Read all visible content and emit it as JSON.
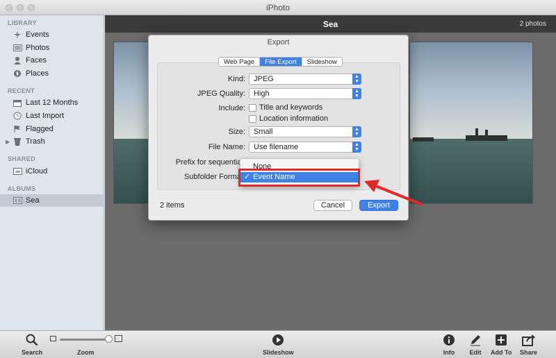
{
  "window": {
    "title": "iPhoto"
  },
  "sidebar": {
    "sections": [
      {
        "heading": "LIBRARY",
        "items": [
          {
            "label": "Events",
            "icon": "events-icon"
          },
          {
            "label": "Photos",
            "icon": "photos-icon"
          },
          {
            "label": "Faces",
            "icon": "faces-icon"
          },
          {
            "label": "Places",
            "icon": "places-icon"
          }
        ]
      },
      {
        "heading": "RECENT",
        "items": [
          {
            "label": "Last 12 Months",
            "icon": "calendar-icon"
          },
          {
            "label": "Last Import",
            "icon": "clock-icon"
          },
          {
            "label": "Flagged",
            "icon": "flag-icon"
          },
          {
            "label": "Trash",
            "icon": "trash-icon"
          }
        ]
      },
      {
        "heading": "SHARED",
        "items": [
          {
            "label": "iCloud",
            "icon": "icloud-icon"
          }
        ]
      },
      {
        "heading": "ALBUMS",
        "items": [
          {
            "label": "Sea",
            "icon": "album-icon",
            "selected": true
          }
        ]
      }
    ]
  },
  "main": {
    "title": "Sea",
    "photo_count": "2 photos"
  },
  "dialog": {
    "title": "Export",
    "tabs": [
      {
        "label": "Web Page",
        "active": false
      },
      {
        "label": "File Export",
        "active": true
      },
      {
        "label": "Slideshow",
        "active": false
      }
    ],
    "fields": {
      "kind": {
        "label": "Kind:",
        "value": "JPEG"
      },
      "jpeg_quality": {
        "label": "JPEG Quality:",
        "value": "High"
      },
      "include": {
        "label": "Include:",
        "options": [
          "Title and keywords",
          "Location information"
        ],
        "checked": [
          false,
          false
        ]
      },
      "size": {
        "label": "Size:",
        "value": "Small"
      },
      "file_name": {
        "label": "File Name:",
        "value": "Use filename"
      },
      "prefix": {
        "label": "Prefix for sequential:"
      },
      "subfolder_format": {
        "label": "Subfolder Format:"
      }
    },
    "popup_options": [
      {
        "label": "None",
        "selected": false
      },
      {
        "label": "Event Name",
        "selected": true
      }
    ],
    "items_count": "2 items",
    "cancel_label": "Cancel",
    "export_label": "Export"
  },
  "toolbar": {
    "search_label": "Search",
    "zoom_label": "Zoom",
    "slideshow_label": "Slideshow",
    "info_label": "Info",
    "edit_label": "Edit",
    "add_to_label": "Add To",
    "share_label": "Share"
  },
  "colors": {
    "accent": "#3f82e6",
    "highlight": "#e02a2a"
  }
}
